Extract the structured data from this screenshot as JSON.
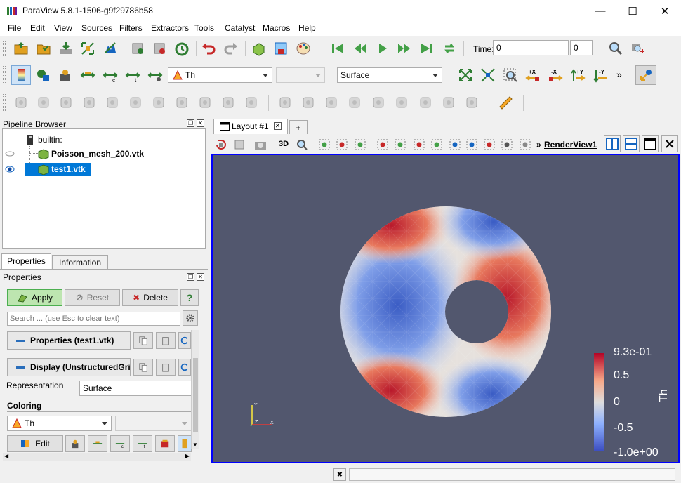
{
  "window": {
    "title": "ParaView 5.8.1-1506-g9f29786b58",
    "minimize": "—",
    "maximize": "☐",
    "close": "✕"
  },
  "menu": [
    "File",
    "Edit",
    "View",
    "Sources",
    "Filters",
    "Extractors",
    "Tools",
    "Catalyst",
    "Macros",
    "Help"
  ],
  "time_toolbar": {
    "label": "Time:",
    "value": "0",
    "index": "0"
  },
  "common_toolbar": {
    "array_combo": "Th",
    "component_combo": "",
    "representation_combo": "Surface",
    "more": "»"
  },
  "pipeline_browser": {
    "title": "Pipeline Browser",
    "root": "builtin:",
    "items": [
      {
        "label": "Poisson_mesh_200.vtk",
        "visible": false,
        "selected": false
      },
      {
        "label": "test1.vtk",
        "visible": true,
        "selected": true
      }
    ]
  },
  "properties_panel": {
    "tabs": [
      "Properties",
      "Information"
    ],
    "active_tab": "Properties",
    "title": "Properties",
    "apply": "Apply",
    "reset": "Reset",
    "delete": "Delete",
    "help": "?",
    "search_placeholder": "Search ... (use Esc to clear text)",
    "section_properties": "Properties (test1.vtk)",
    "section_display": "Display (UnstructuredGrid)",
    "representation_label": "Representation",
    "representation_value": "Surface",
    "coloring_label": "Coloring",
    "coloring_value": "Th",
    "edit": "Edit"
  },
  "layout": {
    "tab": "Layout #1",
    "add_tab": "+",
    "toggle_3d": "3D",
    "view_name": "RenderView1",
    "view_prefix": "»"
  },
  "colorbar": {
    "title": "Th",
    "labels": [
      "9.3e-01",
      "0.5",
      "0",
      "-0.5",
      "-1.0e+00"
    ],
    "colors": {
      "high": "#b40426",
      "mid": "#dddddd",
      "low": "#3b4cc0"
    }
  },
  "axes": {
    "y": "Y",
    "z": "Z",
    "x": "X"
  },
  "colors": {
    "selection": "#0078d7",
    "viewport_bg": "#52576e",
    "viewport_border": "#0000ff"
  }
}
